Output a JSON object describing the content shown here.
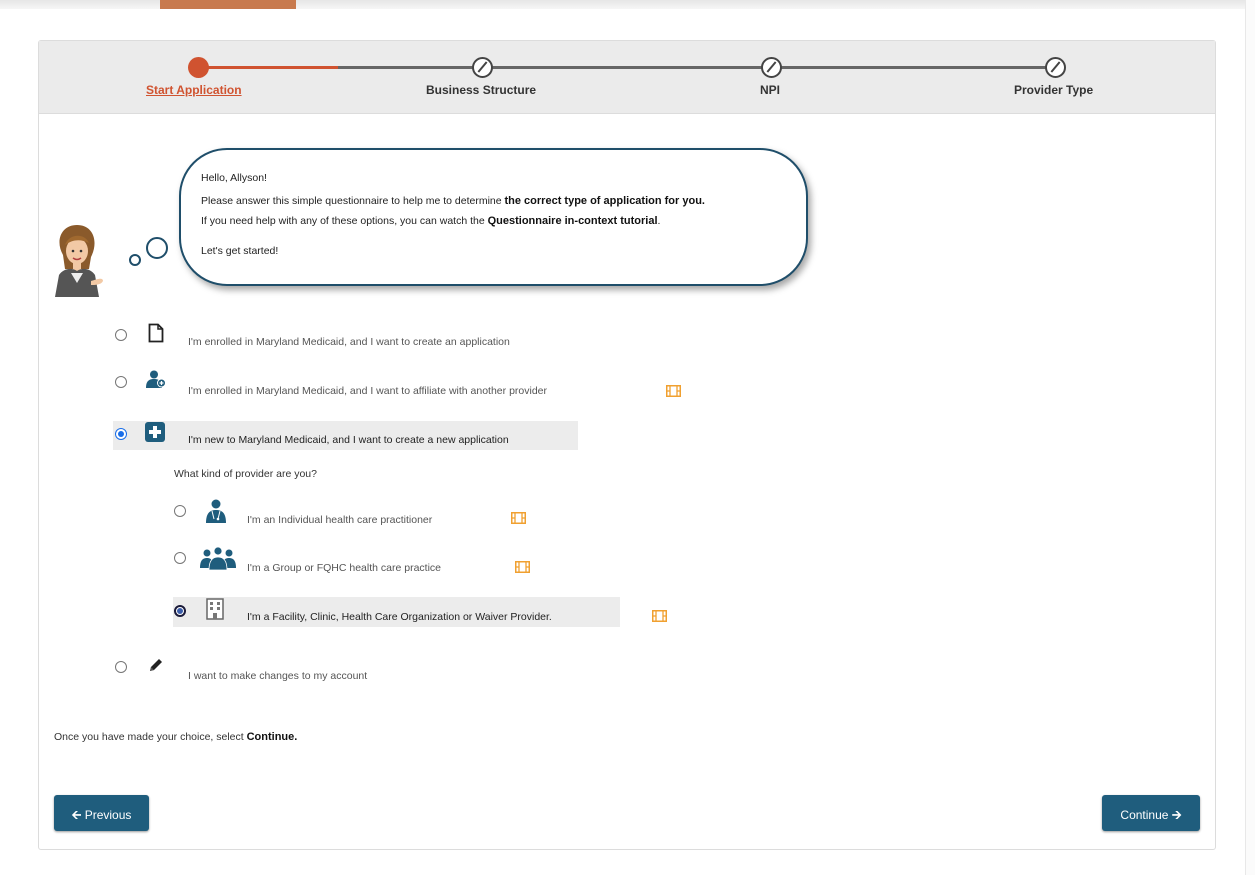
{
  "stepper": {
    "steps": [
      {
        "label": "Start Application",
        "state": "active"
      },
      {
        "label": "Business Structure",
        "state": "disabled"
      },
      {
        "label": "NPI",
        "state": "disabled"
      },
      {
        "label": "Provider Type",
        "state": "disabled"
      }
    ]
  },
  "bubble": {
    "greeting": "Hello, Allyson!",
    "line1_prefix": "Please answer this simple questionnaire to help me to determine ",
    "line1_bold": "the correct type of application for you.",
    "line2_prefix": "If you need help with any of these options, you can watch the ",
    "line2_bold": "Questionnaire in-context tutorial",
    "line2_suffix": ".",
    "line3": "Let's get started!"
  },
  "options": [
    {
      "label": "I'm enrolled in Maryland Medicaid, and I want to create an application",
      "icon": "document-icon",
      "selected": false,
      "video": false
    },
    {
      "label": "I'm enrolled in Maryland Medicaid, and I want to affiliate with another provider",
      "icon": "user-link-icon",
      "selected": false,
      "video": true
    },
    {
      "label": "I'm new to Maryland Medicaid, and I want to create a new application",
      "icon": "medical-plus-icon",
      "selected": true,
      "video": false
    },
    {
      "label": "I want to make changes to my account",
      "icon": "pencil-icon",
      "selected": false,
      "video": false
    }
  ],
  "provider_question": "What kind of provider are you?",
  "provider_options": [
    {
      "label": "I'm an Individual health care practitioner",
      "icon": "doctor-icon",
      "selected": false,
      "video": true
    },
    {
      "label": "I'm a Group or FQHC health care practice",
      "icon": "group-doctors-icon",
      "selected": false,
      "video": true
    },
    {
      "label": "I'm a Facility, Clinic, Health Care Organization or Waiver Provider.",
      "icon": "building-icon",
      "selected": true,
      "video": true
    }
  ],
  "footer_note": {
    "prefix": "Once you have made your choice, select ",
    "bold": "Continue."
  },
  "buttons": {
    "previous": "Previous",
    "continue": "Continue"
  },
  "colors": {
    "accent": "#d05330",
    "primary": "#1f5d7d",
    "video_icon": "#f0a030",
    "bubble_border": "#1f4e6a"
  }
}
